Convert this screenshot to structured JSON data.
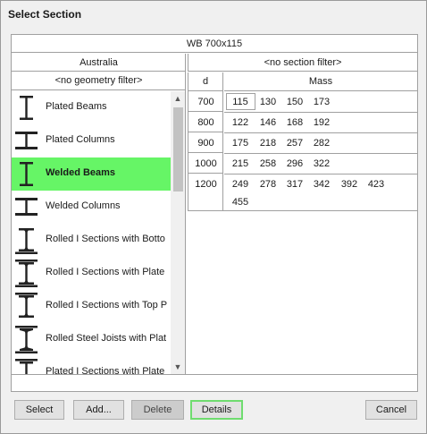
{
  "window": {
    "title": "Select Section"
  },
  "section_name": "WB 700x115",
  "left_panel": {
    "header": "Australia",
    "geometry_filter": "<no geometry filter>",
    "items": [
      {
        "label": "Plated Beams",
        "icon": "plated-beam-icon"
      },
      {
        "label": "Plated Columns",
        "icon": "plated-column-icon"
      },
      {
        "label": "Welded Beams",
        "icon": "welded-beam-icon",
        "selected": true
      },
      {
        "label": "Welded Columns",
        "icon": "welded-column-icon"
      },
      {
        "label": "Rolled I Sections with Botto",
        "icon": "rolled-i-bottom-plate-icon"
      },
      {
        "label": "Rolled I Sections with Plate",
        "icon": "rolled-i-plate-icon"
      },
      {
        "label": "Rolled I Sections with Top P",
        "icon": "rolled-i-top-plate-icon"
      },
      {
        "label": "Rolled Steel Joists with Plat",
        "icon": "rolled-steel-joist-icon"
      },
      {
        "label": "Plated I Sections with Plate",
        "icon": "plated-i-section-icon"
      }
    ]
  },
  "right_panel": {
    "section_filter": "<no section filter>",
    "col_d_header": "d",
    "col_mass_header": "Mass",
    "rows": [
      {
        "d": "700",
        "mass": [
          "115",
          "130",
          "150",
          "173"
        ]
      },
      {
        "d": "800",
        "mass": [
          "122",
          "146",
          "168",
          "192"
        ]
      },
      {
        "d": "900",
        "mass": [
          "175",
          "218",
          "257",
          "282"
        ]
      },
      {
        "d": "1000",
        "mass": [
          "215",
          "258",
          "296",
          "322"
        ]
      },
      {
        "d": "1200",
        "mass": [
          "249",
          "278",
          "317",
          "342",
          "392",
          "423",
          "455"
        ]
      }
    ]
  },
  "buttons": {
    "select": "Select",
    "add": "Add...",
    "delete": "Delete",
    "details": "Details",
    "cancel": "Cancel"
  },
  "colors": {
    "selected_row": "#66f566",
    "focus_border": "#6fdc6f"
  }
}
